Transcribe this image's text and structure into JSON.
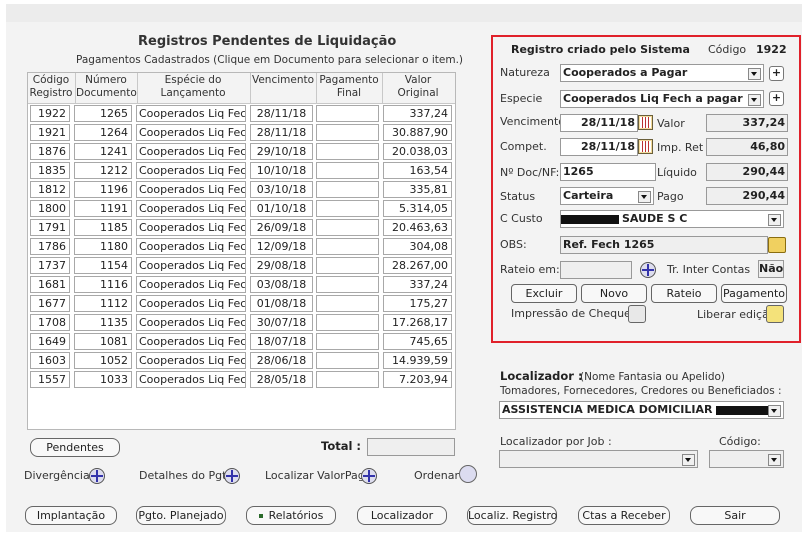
{
  "left": {
    "title": "Registros Pendentes de Liquidação",
    "subtitle": "Pagamentos Cadastrados (Clique em Documento para selecionar o item.)",
    "columns": [
      "Código Registro",
      "Número Documento",
      "Espécie do Lançamento",
      "Vencimento",
      "Pagamento Final",
      "Valor Original"
    ],
    "rows": [
      {
        "codigo": "1922",
        "documento": "1265",
        "especie": "Cooperados Liq Fech a",
        "vencimento": "28/11/18",
        "pagamento": "",
        "valor": "337,24"
      },
      {
        "codigo": "1921",
        "documento": "1264",
        "especie": "Cooperados Liq Fech a",
        "vencimento": "28/11/18",
        "pagamento": "",
        "valor": "30.887,90"
      },
      {
        "codigo": "1876",
        "documento": "1241",
        "especie": "Cooperados Liq Fech a",
        "vencimento": "29/10/18",
        "pagamento": "",
        "valor": "20.038,03"
      },
      {
        "codigo": "1835",
        "documento": "1212",
        "especie": "Cooperados Liq Fech a",
        "vencimento": "10/10/18",
        "pagamento": "",
        "valor": "163,54"
      },
      {
        "codigo": "1812",
        "documento": "1196",
        "especie": "Cooperados Liq Fech a",
        "vencimento": "03/10/18",
        "pagamento": "",
        "valor": "335,81"
      },
      {
        "codigo": "1800",
        "documento": "1191",
        "especie": "Cooperados Liq Fech a",
        "vencimento": "01/10/18",
        "pagamento": "",
        "valor": "5.314,05"
      },
      {
        "codigo": "1791",
        "documento": "1185",
        "especie": "Cooperados Liq Fech a",
        "vencimento": "26/09/18",
        "pagamento": "",
        "valor": "20.463,63"
      },
      {
        "codigo": "1786",
        "documento": "1180",
        "especie": "Cooperados Liq Fech a",
        "vencimento": "12/09/18",
        "pagamento": "",
        "valor": "304,08"
      },
      {
        "codigo": "1737",
        "documento": "1154",
        "especie": "Cooperados Liq Fech a",
        "vencimento": "29/08/18",
        "pagamento": "",
        "valor": "28.267,00"
      },
      {
        "codigo": "1681",
        "documento": "1116",
        "especie": "Cooperados Liq Fech a",
        "vencimento": "03/08/18",
        "pagamento": "",
        "valor": "337,24"
      },
      {
        "codigo": "1677",
        "documento": "1112",
        "especie": "Cooperados Liq Fech a",
        "vencimento": "01/08/18",
        "pagamento": "",
        "valor": "175,27"
      },
      {
        "codigo": "1708",
        "documento": "1135",
        "especie": "Cooperados Liq Fech a",
        "vencimento": "30/07/18",
        "pagamento": "",
        "valor": "17.268,17"
      },
      {
        "codigo": "1649",
        "documento": "1081",
        "especie": "Cooperados Liq Fech a",
        "vencimento": "18/07/18",
        "pagamento": "",
        "valor": "745,65"
      },
      {
        "codigo": "1603",
        "documento": "1052",
        "especie": "Cooperados Liq Fech a",
        "vencimento": "28/06/18",
        "pagamento": "",
        "valor": "14.939,59"
      },
      {
        "codigo": "1557",
        "documento": "1033",
        "especie": "Cooperados Liq Fech a",
        "vencimento": "28/05/18",
        "pagamento": "",
        "valor": "7.203,94"
      }
    ],
    "pendentes_button": "Pendentes",
    "total_label": "Total :",
    "total_value": "",
    "divergencias_label": "Divergências",
    "detalhes_label": "Detalhes do Pgto",
    "localizar_valor_label": "Localizar ValorPago",
    "ordenar_label": "Ordenar"
  },
  "form": {
    "header": "Registro criado pelo Sistema",
    "codigo_label": "Código",
    "codigo_value": "1922",
    "natureza_label": "Natureza",
    "natureza_value": "Cooperados a Pagar",
    "especie_label": "Especie",
    "especie_value": "Cooperados Liq Fech a pagar",
    "vencimento_label": "Vencimento",
    "vencimento_value": "28/11/18",
    "valor_label": "Valor",
    "valor_value": "337,24",
    "compet_label": "Compet.",
    "compet_value": "28/11/18",
    "imp_ret_label": "Imp. Ret",
    "imp_ret_value": "46,80",
    "nodoc_label": "Nº Doc/NF:",
    "nodoc_value": "1265",
    "liquido_label": "Líquido",
    "liquido_value": "290,44",
    "status_label": "Status",
    "status_value": "Carteira",
    "pago_label": "Pago",
    "pago_value": "290,44",
    "ccusto_label": "C Custo",
    "ccusto_value": "SAUDE S C",
    "obs_label": "OBS:",
    "obs_value": "Ref. Fech 1265",
    "rateio_label": "Rateio em:",
    "rateio_value": "",
    "tr_inter_label": "Tr. Inter Contas",
    "tr_inter_value": "Não",
    "buttons": {
      "excluir": "Excluir",
      "novo": "Novo",
      "rateio": "Rateio",
      "pagamento": "Pagamento"
    },
    "impressao_label": "Impressão de Cheques",
    "liberar_label": "Liberar edição"
  },
  "localizador": {
    "title": "Localizador :",
    "hint": "(Nome Fantasia ou Apelido)",
    "subtitle": "Tomadores, Fornecedores, Credores ou Beneficiados :",
    "value": "ASSISTENCIA MEDICA DOMICILIAR",
    "job_label": "Localizador por Job :",
    "job_value": "",
    "codigo_label": "Código:",
    "codigo_value": ""
  },
  "bottom_buttons": [
    "Implantação",
    "Pgto. Planejado",
    "Relatórios",
    "Localizador",
    "Localiz. Registro",
    "Ctas a Receber",
    "Sair"
  ],
  "colors": {
    "highlight_border": "#e0202a",
    "panel_bg": "#f3f3f3"
  }
}
